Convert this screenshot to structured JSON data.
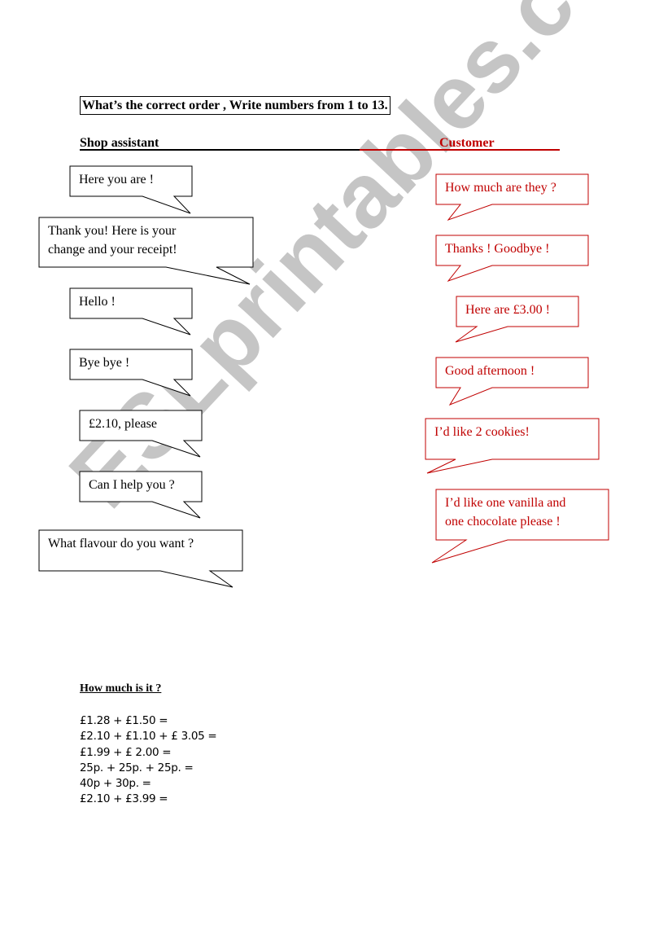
{
  "instruction": "What’s the correct order , Write numbers from 1 to 13.",
  "columns": {
    "shop_assistant": "Shop assistant",
    "customer": "Customer"
  },
  "colors": {
    "assistant": "#000000",
    "customer": "#c00000",
    "watermark": "#969696"
  },
  "shop_assistant_bubbles": [
    {
      "lines": [
        "Here you are !"
      ]
    },
    {
      "lines": [
        "Thank you! Here is your",
        "change and your receipt!"
      ]
    },
    {
      "lines": [
        "Hello !"
      ]
    },
    {
      "lines": [
        "Bye bye !"
      ]
    },
    {
      "lines": [
        "£2.10, please"
      ]
    },
    {
      "lines": [
        "Can I help you ?"
      ]
    },
    {
      "lines": [
        "What flavour do you want ?"
      ]
    }
  ],
  "customer_bubbles": [
    {
      "lines": [
        "How much are they ?"
      ]
    },
    {
      "lines": [
        "Thanks ! Goodbye !"
      ]
    },
    {
      "lines": [
        "Here are £3.00 !"
      ]
    },
    {
      "lines": [
        "Good afternoon !"
      ]
    },
    {
      "lines": [
        "I’d like 2  cookies!"
      ]
    },
    {
      "lines": [
        "I’d like one vanilla and",
        "one chocolate please !"
      ]
    }
  ],
  "sums": {
    "title": "How much is it ?",
    "items": [
      "£1.28 + £1.50 =",
      "£2.10 + £1.10 + £ 3.05 =",
      "£1.99 + £ 2.00 =",
      "25p. + 25p. + 25p. =",
      "40p + 30p. =",
      "£2.10 + £3.99 ="
    ]
  },
  "watermark": "ESLprintables.com"
}
